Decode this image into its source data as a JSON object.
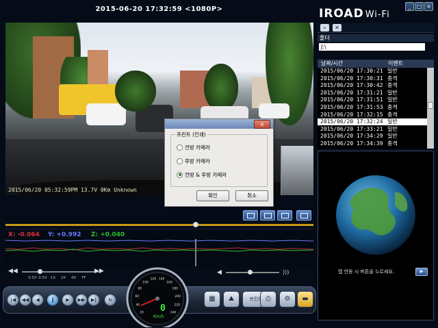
{
  "video": {
    "timestamp": "2015-06-20 17:32:59 <1080P>",
    "osd": "2015/06/20 05:32:59PM 13.7V  0Km Unknown"
  },
  "dialog": {
    "group_label": "프린트 (인쇄)",
    "options": [
      "전방 카메라",
      "후방 카메라",
      "전방 & 후방 카메라"
    ],
    "selected_index": 2,
    "ok_label": "확인",
    "cancel_label": "취소",
    "close_glyph": "x"
  },
  "gsensor": {
    "x_label": "X: -0.064",
    "y_label": "Y: +0.992",
    "z_label": "Z: +0.040",
    "x_color": "#e03030",
    "y_color": "#6b7bff",
    "z_color": "#2fbf2f"
  },
  "speed": {
    "labels": [
      "0.5X",
      "0.5X",
      "1X",
      "2X",
      "4X",
      "FF"
    ]
  },
  "gauge": {
    "value": "0",
    "unit": "Km/h",
    "ticks": [
      "20",
      "40",
      "60",
      "80",
      "100",
      "120",
      "140",
      "160",
      "180",
      "200",
      "220",
      "240"
    ]
  },
  "controls": {
    "print_label": "프린트"
  },
  "header": {
    "logo": "IROAD",
    "logo_suffix": "Wi-Fi"
  },
  "folder": {
    "label": "폴더",
    "value": "J:\\"
  },
  "list": {
    "col_datetime": "날짜/시간",
    "col_event": "이벤트",
    "rows": [
      {
        "dt": "2015/06/20 17:30:21",
        "ev": "일반"
      },
      {
        "dt": "2015/06/20 17:30:31",
        "ev": "충격"
      },
      {
        "dt": "2015/06/20 17:30:42",
        "ev": "충격"
      },
      {
        "dt": "2015/06/20 17:31:21",
        "ev": "일반"
      },
      {
        "dt": "2015/06/20 17:31:51",
        "ev": "일반"
      },
      {
        "dt": "2015/06/20 17:31:53",
        "ev": "충격"
      },
      {
        "dt": "2015/06/20 17:32:15",
        "ev": "충격"
      },
      {
        "dt": "2015/06/20 17:32:24",
        "ev": "일반"
      },
      {
        "dt": "2015/06/20 17:33:21",
        "ev": "일반"
      },
      {
        "dt": "2015/06/20 17:34:29",
        "ev": "일반"
      },
      {
        "dt": "2015/06/20 17:34:39",
        "ev": "충격"
      }
    ],
    "selected_index": 7
  },
  "map": {
    "message": "맵 연동 시 버튼을 누르세요."
  },
  "colors": {
    "timeline": "#c99a17",
    "background": "#050c18",
    "accent": "#2a4f8a"
  }
}
